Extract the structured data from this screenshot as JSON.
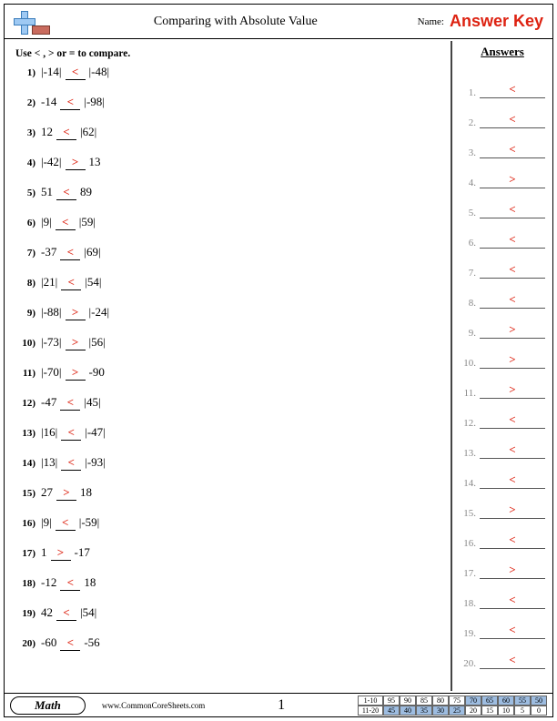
{
  "header": {
    "title": "Comparing with Absolute Value",
    "name_label": "Name:",
    "answer_key": "Answer Key"
  },
  "instruction": "Use < , > or = to compare.",
  "problems": [
    {
      "n": "1",
      "left": "|-14|",
      "sym": "<",
      "right": "|-48|"
    },
    {
      "n": "2",
      "left": "-14",
      "sym": "<",
      "right": "|-98|"
    },
    {
      "n": "3",
      "left": "12",
      "sym": "<",
      "right": "|62|"
    },
    {
      "n": "4",
      "left": "|-42|",
      "sym": ">",
      "right": "13"
    },
    {
      "n": "5",
      "left": "51",
      "sym": "<",
      "right": "89"
    },
    {
      "n": "6",
      "left": "|9|",
      "sym": "<",
      "right": "|59|"
    },
    {
      "n": "7",
      "left": "-37",
      "sym": "<",
      "right": "|69|"
    },
    {
      "n": "8",
      "left": "|21|",
      "sym": "<",
      "right": "|54|"
    },
    {
      "n": "9",
      "left": "|-88|",
      "sym": ">",
      "right": "|-24|"
    },
    {
      "n": "10",
      "left": "|-73|",
      "sym": ">",
      "right": "|56|"
    },
    {
      "n": "11",
      "left": "|-70|",
      "sym": ">",
      "right": "-90"
    },
    {
      "n": "12",
      "left": "-47",
      "sym": "<",
      "right": "|45|"
    },
    {
      "n": "13",
      "left": "|16|",
      "sym": "<",
      "right": "|-47|"
    },
    {
      "n": "14",
      "left": "|13|",
      "sym": "<",
      "right": "|-93|"
    },
    {
      "n": "15",
      "left": "27",
      "sym": ">",
      "right": "18"
    },
    {
      "n": "16",
      "left": "|9|",
      "sym": "<",
      "right": "|-59|"
    },
    {
      "n": "17",
      "left": "1",
      "sym": ">",
      "right": "-17"
    },
    {
      "n": "18",
      "left": "-12",
      "sym": "<",
      "right": "18"
    },
    {
      "n": "19",
      "left": "42",
      "sym": "<",
      "right": "|54|"
    },
    {
      "n": "20",
      "left": "-60",
      "sym": "<",
      "right": "-56"
    }
  ],
  "answers_header": "Answers",
  "answers": [
    "<",
    "<",
    "<",
    ">",
    "<",
    "<",
    "<",
    "<",
    ">",
    ">",
    ">",
    "<",
    "<",
    "<",
    ">",
    "<",
    ">",
    "<",
    "<",
    "<"
  ],
  "footer": {
    "subject": "Math",
    "site": "www.CommonCoreSheets.com",
    "page": "1",
    "score_row1_label": "1-10",
    "score_row1": [
      "95",
      "90",
      "85",
      "80",
      "75",
      "70",
      "65",
      "60",
      "55",
      "50"
    ],
    "score_row2_label": "11-20",
    "score_row2": [
      "45",
      "40",
      "35",
      "30",
      "25",
      "20",
      "15",
      "10",
      "5",
      "0"
    ],
    "row1_shade_from": 5,
    "row2_shade_to": 5
  }
}
